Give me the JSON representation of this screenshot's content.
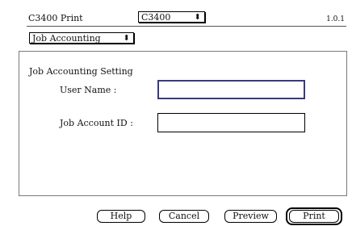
{
  "header": {
    "title": "C3400 Print",
    "printer_select_value": "C3400",
    "version": "1.0.1"
  },
  "panel_select_value": "Job Accounting",
  "section": {
    "title": "Job Accounting Setting",
    "user_name_label": "User Name :",
    "user_name_value": "",
    "job_account_label": "Job Account ID :",
    "job_account_value": ""
  },
  "buttons": {
    "help": "Help",
    "cancel": "Cancel",
    "preview": "Preview",
    "print": "Print"
  },
  "icons": {
    "popup_arrow": "updown-arrows-icon"
  }
}
